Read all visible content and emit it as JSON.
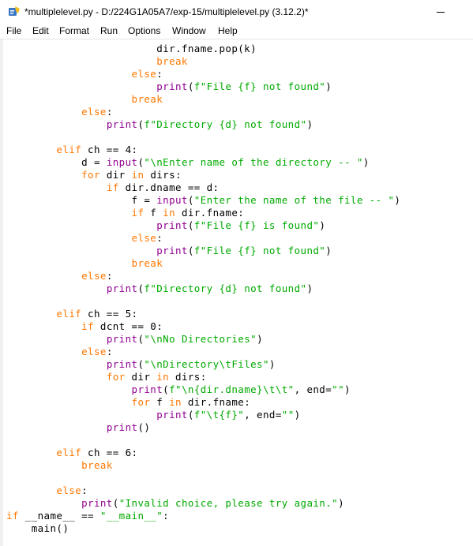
{
  "window": {
    "title": "*multiplelevel.py - D:/224G1A05A7/exp-15/multiplelevel.py (3.12.2)*",
    "icon": "python-idle-icon"
  },
  "menu": [
    "File",
    "Edit",
    "Format",
    "Run",
    "Options",
    "Window",
    "Help"
  ],
  "colors": {
    "keyword": "#ff7700",
    "builtin": "#900090",
    "string": "#00aa00",
    "default": "#000000"
  },
  "code_lines": [
    [
      [
        "df",
        "                        dir.fname.pop(k)"
      ]
    ],
    [
      [
        "df",
        "                        "
      ],
      [
        "kw",
        "break"
      ]
    ],
    [
      [
        "df",
        "                    "
      ],
      [
        "kw",
        "else"
      ],
      [
        "df",
        ":"
      ]
    ],
    [
      [
        "df",
        "                        "
      ],
      [
        "bi",
        "print"
      ],
      [
        "df",
        "("
      ],
      [
        "st",
        "f\"File {f} not found\""
      ],
      [
        "df",
        ")"
      ]
    ],
    [
      [
        "df",
        "                    "
      ],
      [
        "kw",
        "break"
      ]
    ],
    [
      [
        "df",
        "            "
      ],
      [
        "kw",
        "else"
      ],
      [
        "df",
        ":"
      ]
    ],
    [
      [
        "df",
        "                "
      ],
      [
        "bi",
        "print"
      ],
      [
        "df",
        "("
      ],
      [
        "st",
        "f\"Directory {d} not found\""
      ],
      [
        "df",
        ")"
      ]
    ],
    [
      [
        "df",
        ""
      ]
    ],
    [
      [
        "df",
        "        "
      ],
      [
        "kw",
        "elif"
      ],
      [
        "df",
        " ch == 4:"
      ]
    ],
    [
      [
        "df",
        "            d = "
      ],
      [
        "bi",
        "input"
      ],
      [
        "df",
        "("
      ],
      [
        "st",
        "\"\\nEnter name of the directory -- \""
      ],
      [
        "df",
        ")"
      ]
    ],
    [
      [
        "df",
        "            "
      ],
      [
        "kw",
        "for"
      ],
      [
        "df",
        " dir "
      ],
      [
        "kw",
        "in"
      ],
      [
        "df",
        " dirs:"
      ]
    ],
    [
      [
        "df",
        "                "
      ],
      [
        "kw",
        "if"
      ],
      [
        "df",
        " dir.dname == d:"
      ]
    ],
    [
      [
        "df",
        "                    f = "
      ],
      [
        "bi",
        "input"
      ],
      [
        "df",
        "("
      ],
      [
        "st",
        "\"Enter the name of the file -- \""
      ],
      [
        "df",
        ")"
      ]
    ],
    [
      [
        "df",
        "                    "
      ],
      [
        "kw",
        "if"
      ],
      [
        "df",
        " f "
      ],
      [
        "kw",
        "in"
      ],
      [
        "df",
        " dir.fname:"
      ]
    ],
    [
      [
        "df",
        "                        "
      ],
      [
        "bi",
        "print"
      ],
      [
        "df",
        "("
      ],
      [
        "st",
        "f\"File {f} is found\""
      ],
      [
        "df",
        ")"
      ]
    ],
    [
      [
        "df",
        "                    "
      ],
      [
        "kw",
        "else"
      ],
      [
        "df",
        ":"
      ]
    ],
    [
      [
        "df",
        "                        "
      ],
      [
        "bi",
        "print"
      ],
      [
        "df",
        "("
      ],
      [
        "st",
        "f\"File {f} not found\""
      ],
      [
        "df",
        ")"
      ]
    ],
    [
      [
        "df",
        "                    "
      ],
      [
        "kw",
        "break"
      ]
    ],
    [
      [
        "df",
        "            "
      ],
      [
        "kw",
        "else"
      ],
      [
        "df",
        ":"
      ]
    ],
    [
      [
        "df",
        "                "
      ],
      [
        "bi",
        "print"
      ],
      [
        "df",
        "("
      ],
      [
        "st",
        "f\"Directory {d} not found\""
      ],
      [
        "df",
        ")"
      ]
    ],
    [
      [
        "df",
        ""
      ]
    ],
    [
      [
        "df",
        "        "
      ],
      [
        "kw",
        "elif"
      ],
      [
        "df",
        " ch == 5:"
      ]
    ],
    [
      [
        "df",
        "            "
      ],
      [
        "kw",
        "if"
      ],
      [
        "df",
        " dcnt == 0:"
      ]
    ],
    [
      [
        "df",
        "                "
      ],
      [
        "bi",
        "print"
      ],
      [
        "df",
        "("
      ],
      [
        "st",
        "\"\\nNo Directories\""
      ],
      [
        "df",
        ")"
      ]
    ],
    [
      [
        "df",
        "            "
      ],
      [
        "kw",
        "else"
      ],
      [
        "df",
        ":"
      ]
    ],
    [
      [
        "df",
        "                "
      ],
      [
        "bi",
        "print"
      ],
      [
        "df",
        "("
      ],
      [
        "st",
        "\"\\nDirectory\\tFiles\""
      ],
      [
        "df",
        ")"
      ]
    ],
    [
      [
        "df",
        "                "
      ],
      [
        "kw",
        "for"
      ],
      [
        "df",
        " dir "
      ],
      [
        "kw",
        "in"
      ],
      [
        "df",
        " dirs:"
      ]
    ],
    [
      [
        "df",
        "                    "
      ],
      [
        "bi",
        "print"
      ],
      [
        "df",
        "("
      ],
      [
        "st",
        "f\"\\n{dir.dname}\\t\\t\""
      ],
      [
        "df",
        ", end="
      ],
      [
        "st",
        "\"\""
      ],
      [
        "df",
        ")"
      ]
    ],
    [
      [
        "df",
        "                    "
      ],
      [
        "kw",
        "for"
      ],
      [
        "df",
        " f "
      ],
      [
        "kw",
        "in"
      ],
      [
        "df",
        " dir.fname:"
      ]
    ],
    [
      [
        "df",
        "                        "
      ],
      [
        "bi",
        "print"
      ],
      [
        "df",
        "("
      ],
      [
        "st",
        "f\"\\t{f}\""
      ],
      [
        "df",
        ", end="
      ],
      [
        "st",
        "\"\""
      ],
      [
        "df",
        ")"
      ]
    ],
    [
      [
        "df",
        "                "
      ],
      [
        "bi",
        "print"
      ],
      [
        "df",
        "()"
      ]
    ],
    [
      [
        "df",
        ""
      ]
    ],
    [
      [
        "df",
        "        "
      ],
      [
        "kw",
        "elif"
      ],
      [
        "df",
        " ch == 6:"
      ]
    ],
    [
      [
        "df",
        "            "
      ],
      [
        "kw",
        "break"
      ]
    ],
    [
      [
        "df",
        ""
      ]
    ],
    [
      [
        "df",
        "        "
      ],
      [
        "kw",
        "else"
      ],
      [
        "df",
        ":"
      ]
    ],
    [
      [
        "df",
        "            "
      ],
      [
        "bi",
        "print"
      ],
      [
        "df",
        "("
      ],
      [
        "st",
        "\"Invalid choice, please try again.\""
      ],
      [
        "df",
        ")"
      ]
    ],
    [
      [
        "kw",
        "if"
      ],
      [
        "df",
        " __name__ == "
      ],
      [
        "st",
        "\"__main__\""
      ],
      [
        "df",
        ":"
      ]
    ],
    [
      [
        "df",
        "    main()"
      ]
    ]
  ]
}
